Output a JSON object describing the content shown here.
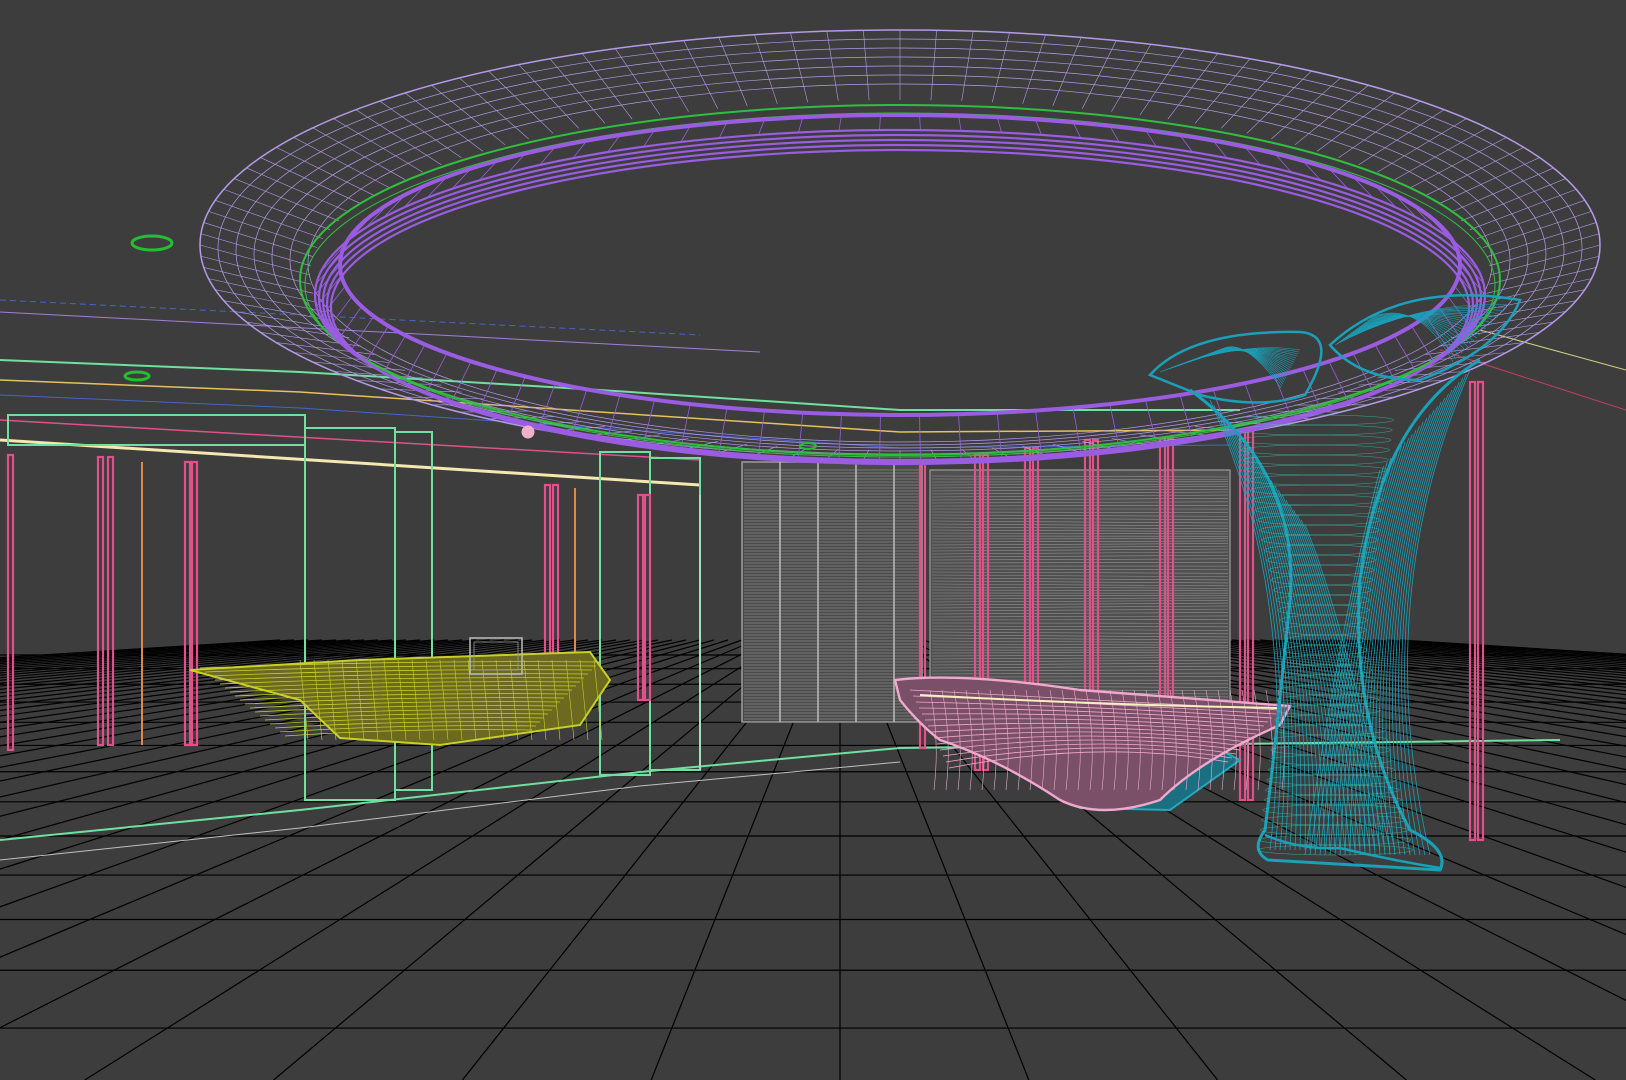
{
  "viewport": {
    "render_mode": "wireframe",
    "background_color": "#3d3d3d",
    "grid_color": "#000000"
  },
  "colors": {
    "ceiling_ring": "#9a5ce0",
    "ceiling_ring_outer": "#b49ae8",
    "cove_light_strip": "#2fbf3f",
    "wall_posts": "#e0508a",
    "glass_partitions": "#6fe0a0",
    "reception_desk_left": "#c8d028",
    "reception_desk_right": "#f0a8cc",
    "desk_base_right": "#22a8c0",
    "tree_column": "#1aa0b8",
    "louver_screen": "#9c9c9c",
    "ceiling_light_ring": "#22c030",
    "beam_line_cream": "#f4e8b0",
    "orange_post": "#e08848",
    "guide_blue": "#4466cc"
  },
  "objects": [
    {
      "name": "ceiling-ring",
      "icon": "ellipse-wireframe"
    },
    {
      "name": "tree-column",
      "icon": "organic-column-wireframe"
    },
    {
      "name": "reception-desk-left",
      "icon": "desk-wireframe"
    },
    {
      "name": "reception-desk-right",
      "icon": "desk-wireframe"
    },
    {
      "name": "louver-screen",
      "icon": "louver-panel-wireframe"
    },
    {
      "name": "floor-grid",
      "icon": "grid"
    }
  ]
}
